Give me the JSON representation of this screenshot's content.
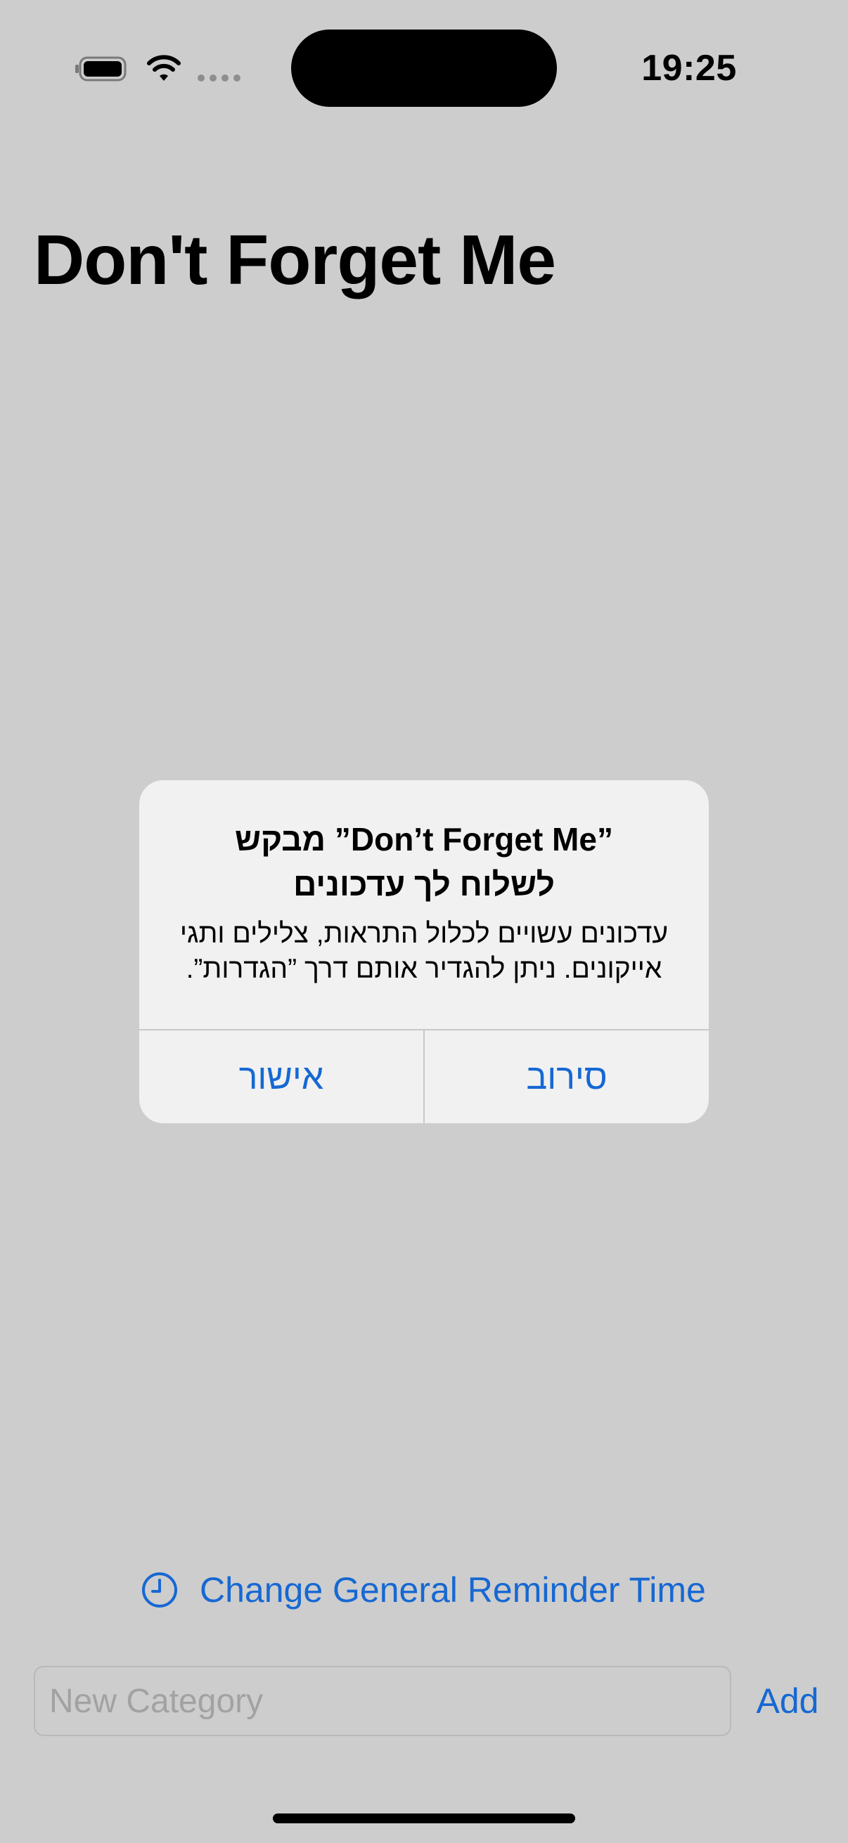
{
  "status_bar": {
    "time": "19:25",
    "icons": [
      "battery-icon",
      "wifi-icon",
      "signal-icon"
    ]
  },
  "app": {
    "title": "Don't Forget Me"
  },
  "alert": {
    "title_line1": "”Don’t Forget Me” מבקש",
    "title_line2": "לשלוח לך עדכונים",
    "message_line1": "עדכונים עשויים לכלול התראות, צלילים ותגי",
    "message_line2": "אייקונים. ניתן להגדיר אותם דרך ”הגדרות”.",
    "allow_label": "אישור",
    "deny_label": "סירוב"
  },
  "reminder": {
    "label": "Change General Reminder Time",
    "icon": "clock-icon"
  },
  "new_category": {
    "value": "",
    "placeholder": "New Category",
    "add_label": "Add"
  },
  "colors": {
    "background": "#cdcdcd",
    "accent": "#1668d3",
    "alert_bg": "#f1f1f1"
  }
}
